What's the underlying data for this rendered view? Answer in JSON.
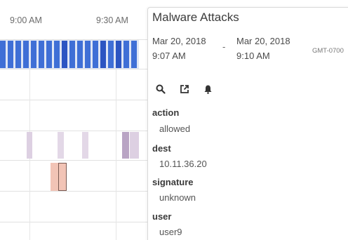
{
  "timeline": {
    "time_labels": [
      "9:00 AM",
      "9:30 AM"
    ]
  },
  "panel": {
    "title": "Malware Attacks",
    "start": {
      "date": "Mar 20, 2018",
      "time": "9:07 AM"
    },
    "separator": "-",
    "end": {
      "date": "Mar 20, 2018",
      "time": "9:10 AM"
    },
    "timezone": "GMT-0700",
    "icons": [
      "search-icon",
      "open-in-new-icon",
      "bell-icon"
    ],
    "fields": [
      {
        "name": "action",
        "value": "allowed"
      },
      {
        "name": "dest",
        "value": "10.11.36.20"
      },
      {
        "name": "signature",
        "value": "unknown"
      },
      {
        "name": "user",
        "value": "user9"
      }
    ]
  },
  "colors": {
    "top_row_blue": "#3f6fd6",
    "top_row_blue_dark": "#2c55c2",
    "purple_light": "#ddd0e2",
    "purple_dark": "#b9a4c4",
    "orange": "#f2c4b6",
    "orange_border": "#7a5a52"
  }
}
